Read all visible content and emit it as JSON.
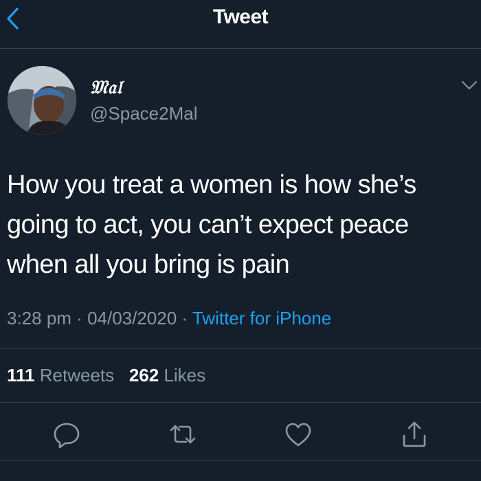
{
  "header": {
    "title": "Tweet"
  },
  "tweet": {
    "display_name": "𝔐𝔞𝔩",
    "handle": "@Space2Mal",
    "text_lines": [
      "How you treat a women is how she’s",
      "going to act, you can’t expect peace",
      "when all you bring is pain"
    ],
    "time": "3:28 pm",
    "separator": " · ",
    "date": "04/03/2020",
    "source": "Twitter for iPhone"
  },
  "stats": {
    "retweets_count": "111",
    "retweets_label": "Retweets",
    "likes_count": "262",
    "likes_label": "Likes"
  },
  "colors": {
    "background": "#151f2b",
    "text": "#ffffff",
    "muted": "#8899a6",
    "accent": "#1da1f2",
    "divider": "#38444d"
  },
  "icons": {
    "back": "chevron-left-icon",
    "caret": "chevron-down-icon",
    "reply": "reply-icon",
    "retweet": "retweet-icon",
    "like": "heart-icon",
    "share": "share-icon"
  }
}
